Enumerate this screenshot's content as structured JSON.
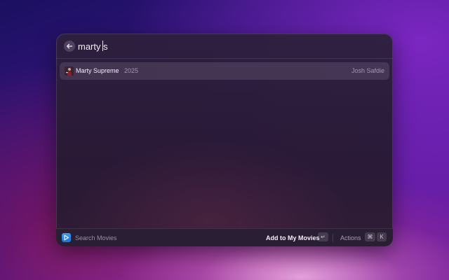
{
  "search": {
    "query": "marty s"
  },
  "results": [
    {
      "title": "Marty Supreme",
      "year": "2025",
      "director": "Josh Safdie",
      "icon": "movie-poster"
    }
  ],
  "footer": {
    "extension_name": "Search Movies",
    "extension_icon": "search-movies-icon",
    "primary_action": "Add to My Movies",
    "primary_action_key": "↵",
    "actions_label": "Actions",
    "actions_keys": [
      "⌘",
      "K"
    ]
  },
  "colors": {
    "accent": "#2a7fe0",
    "selection": "#ffffff1c"
  }
}
